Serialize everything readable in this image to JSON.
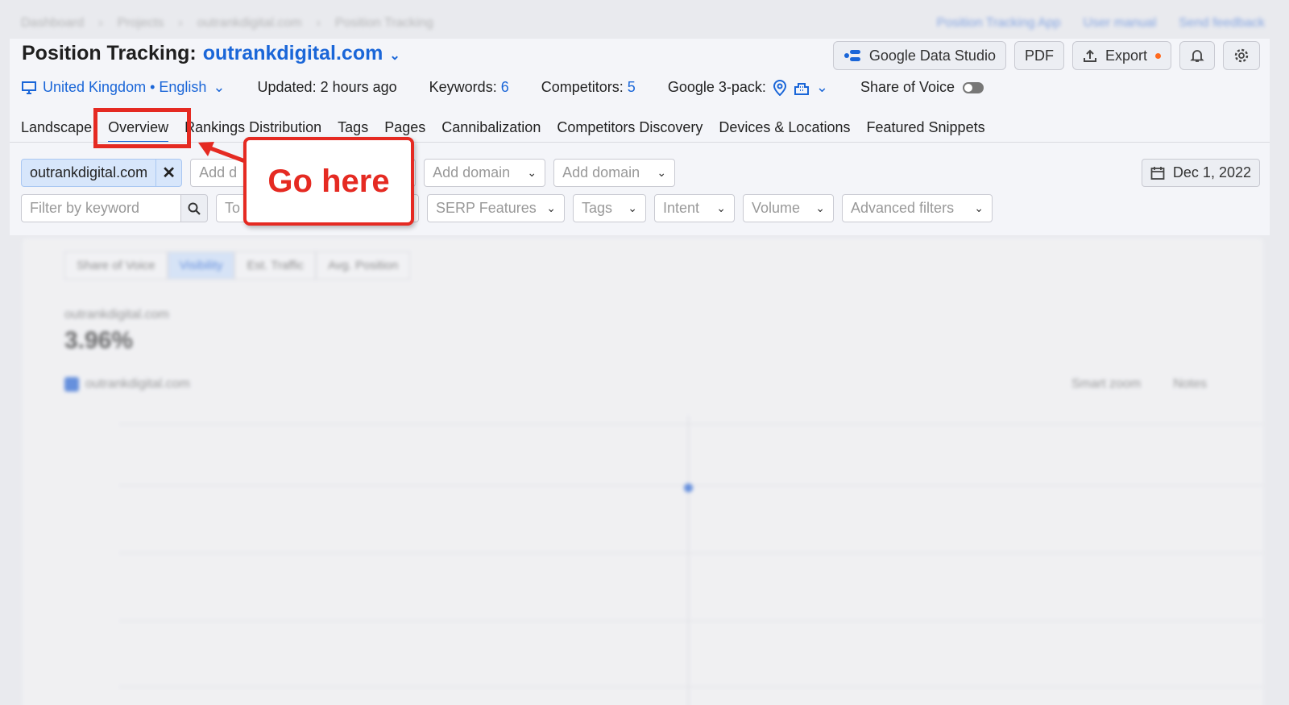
{
  "background": {
    "breadcrumbs": [
      "Dashboard",
      "Projects",
      "outrankdigital.com",
      "Position Tracking"
    ],
    "top_links": [
      "Position Tracking App",
      "User manual",
      "Send feedback"
    ],
    "chart_tabs": [
      "Share of Voice",
      "Visibility",
      "Est. Traffic",
      "Avg. Position"
    ],
    "domain": "outrankdigital.com",
    "value": "3.96%",
    "legend": "outrankdigital.com",
    "smart_zoom": "Smart zoom",
    "notes": "Notes"
  },
  "header": {
    "title_prefix": "Position Tracking:",
    "domain": "outrankdigital.com",
    "buttons": {
      "gds": "Google Data Studio",
      "pdf": "PDF",
      "export": "Export"
    }
  },
  "meta": {
    "location": "United Kingdom • English",
    "updated": "Updated: 2 hours ago",
    "keywords_label": "Keywords:",
    "keywords_value": "6",
    "competitors_label": "Competitors:",
    "competitors_value": "5",
    "google3pack_label": "Google 3-pack:",
    "share_of_voice": "Share of Voice"
  },
  "tabs": [
    "Landscape",
    "Overview",
    "Rankings Distribution",
    "Tags",
    "Pages",
    "Cannibalization",
    "Competitors Discovery",
    "Devices & Locations",
    "Featured Snippets"
  ],
  "filters": {
    "domain_chip": "outrankdigital.com",
    "add_domain_partial": "Add d",
    "add_domain": "Add domain",
    "date": "Dec 1, 2022",
    "keyword_placeholder": "Filter by keyword",
    "top_partial": "To",
    "serp_features": "SERP Features",
    "tags": "Tags",
    "intent": "Intent",
    "volume": "Volume",
    "advanced": "Advanced filters"
  },
  "annotation": {
    "callout": "Go here"
  },
  "colors": {
    "accent": "#1a66d8",
    "annotation": "#e52a22"
  }
}
